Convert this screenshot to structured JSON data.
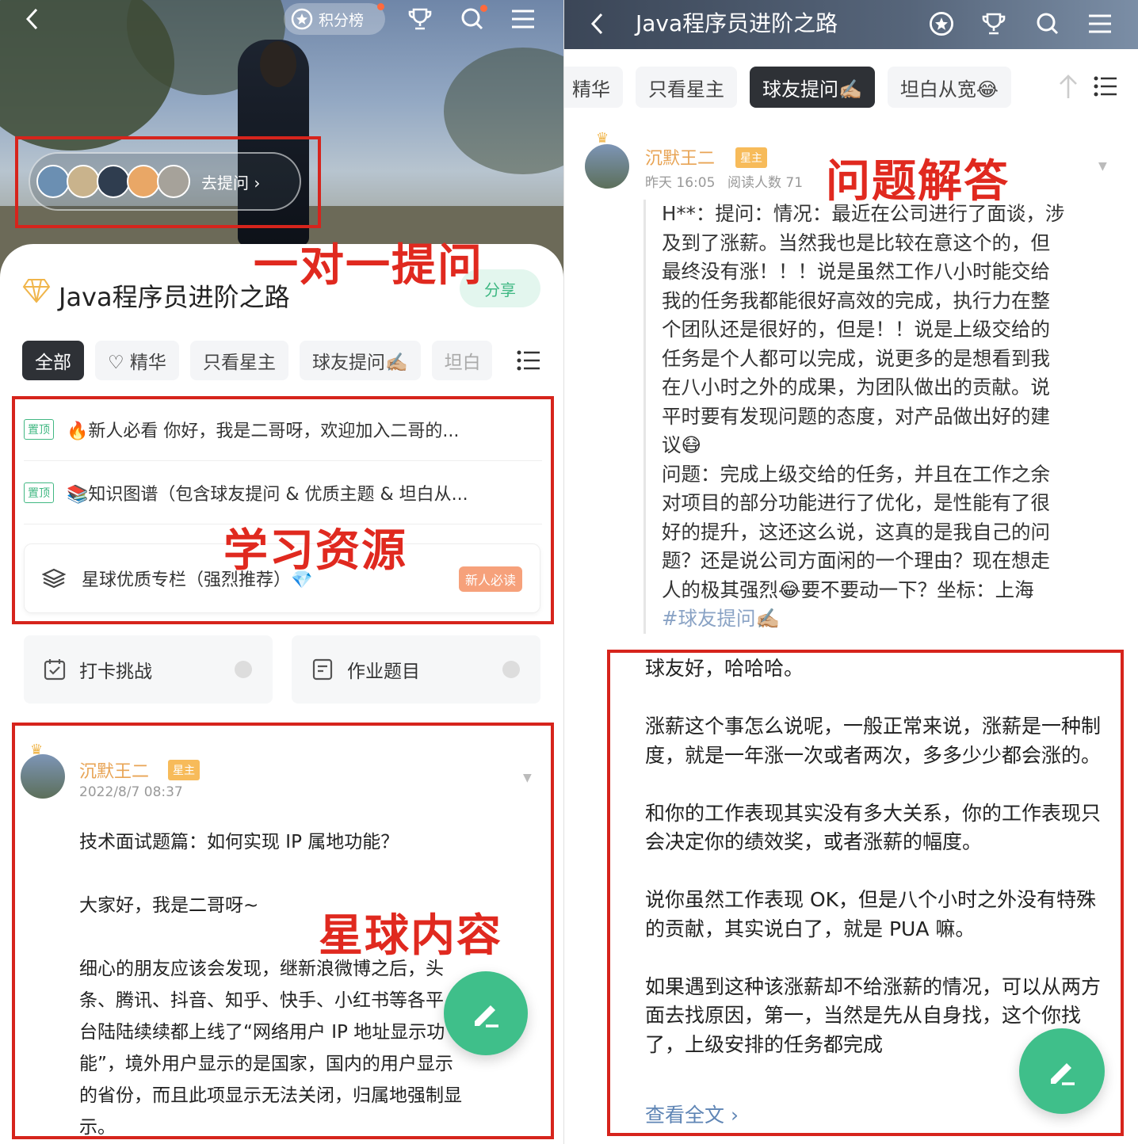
{
  "left": {
    "topbar": {
      "rank_label": "积分榜"
    },
    "ask_pill": {
      "label": "去提问 ›"
    },
    "group_title": "Java程序员进阶之路",
    "share_label": "分享",
    "tabs": [
      {
        "label": "全部"
      },
      {
        "label": "♡ 精华"
      },
      {
        "label": "只看星主"
      },
      {
        "label": "球友提问✍🏼"
      },
      {
        "label": "坦白"
      }
    ],
    "pinned": [
      {
        "tag": "置顶",
        "text": "🔥新人必看 你好，我是二哥呀，欢迎加入二哥的..."
      },
      {
        "tag": "置顶",
        "text": "📚知识图谱（包含球友提问 & 优质主题 & 坦白从..."
      }
    ],
    "column": {
      "label": "星球优质专栏（强烈推荐）💎",
      "badge": "新人必读"
    },
    "features": [
      {
        "label": "打卡挑战"
      },
      {
        "label": "作业题目"
      }
    ],
    "post": {
      "author": "沉默王二",
      "role": "星主",
      "date": "2022/8/7 08:37",
      "title": "技术面试题篇：如何实现 IP 属地功能？",
      "greeting": "大家好，我是二哥呀~",
      "body_lines": [
        "细心的朋友应该会发现，继新浪微博之后，头",
        "条、腾讯、抖音、知乎、快手、小红书等各平",
        "台陆陆续续都上线了“网络用户 IP 地址显示功",
        "能”，境外用户显示的是国家，国内的用户显示",
        "的省份，而且此项显示无法关闭，归属地强制显",
        "示。"
      ]
    },
    "annotations": {
      "ask": "一对一提问",
      "resources": "学习资源",
      "content": "星球内容"
    }
  },
  "right": {
    "title": "Java程序员进阶之路",
    "tabs": [
      {
        "label": "精华"
      },
      {
        "label": "只看星主"
      },
      {
        "label": "球友提问✍🏼"
      },
      {
        "label": "坦白从宽😂"
      }
    ],
    "post": {
      "author": "沉默王二",
      "role": "星主",
      "time": "昨天 16:05",
      "reads": "阅读人数 71"
    },
    "question_lines": [
      "H**：提问：情况：最近在公司进行了面谈，涉",
      "及到了涨薪。当然我也是比较在意这个的，但",
      "最终没有涨！！！说是虽然工作八小时能交给",
      "我的任务我都能很好高效的完成，执行力在整",
      "个团队还是很好的，但是！！说是上级交给的",
      "任务是个人都可以完成，说更多的是想看到我",
      "在八小时之外的成果，为团队做出的贡献。说",
      "平时要有发现问题的态度，对产品做出好的建",
      "议😷",
      "问题：完成上级交给的任务，并且在工作之余",
      "对项目的部分功能进行了优化，是性能有了很",
      "好的提升，这还这么说，这真的是我自己的问",
      "题？还是说公司方面闲的一个理由？现在想走",
      "人的极其强烈😂要不要动一下？坐标：上海"
    ],
    "hashtag": "#球友提问✍🏼",
    "answer_paragraphs": [
      "球友好，哈哈哈。",
      "涨薪这个事怎么说呢，一般正常来说，涨薪是一种制度，就是一年涨一次或者两次，多多少少都会涨的。",
      "和你的工作表现其实没有多大关系，你的工作表现只会决定你的绩效奖，或者涨薪的幅度。",
      "说你虽然工作表现 OK，但是八个小时之外没有特殊的贡献，其实说白了，就是 PUA 嘛。",
      "如果遇到这种该涨薪却不给涨薪的情况，可以从两方面去找原因，第一，当然是先从自身找，这个你找了，上级安排的任务都完成"
    ],
    "read_more": "查看全文 ›",
    "annotations": {
      "answer": "问题解答"
    }
  },
  "colors": {
    "accent": "#3fbf8a",
    "annotation_red": "#d6241c",
    "author_gold": "#e8a455",
    "tab_active": "#2e3136"
  }
}
